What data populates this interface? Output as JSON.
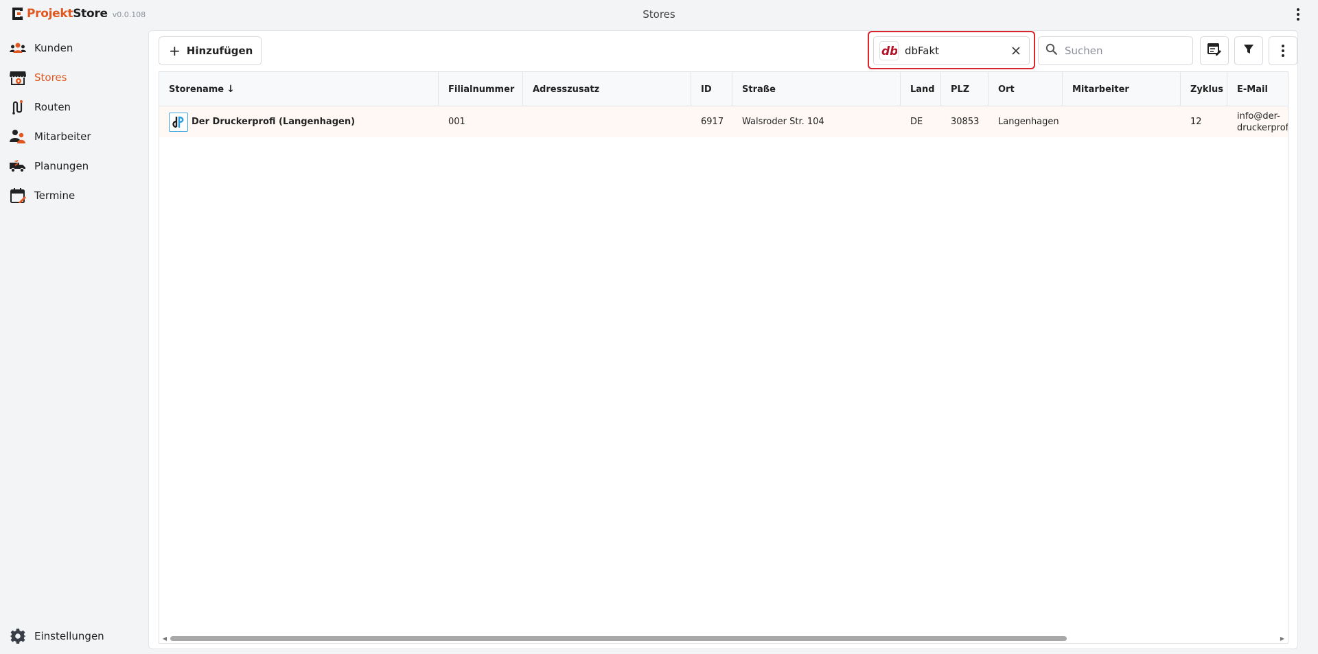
{
  "app": {
    "name_part1": "Projekt",
    "name_part2": "Store",
    "version": "v0.0.108",
    "page_title": "Stores"
  },
  "sidebar": {
    "items": [
      {
        "label": "Kunden",
        "icon": "people-icon"
      },
      {
        "label": "Stores",
        "icon": "store-icon",
        "active": true
      },
      {
        "label": "Routen",
        "icon": "route-icon"
      },
      {
        "label": "Mitarbeiter",
        "icon": "employees-icon"
      },
      {
        "label": "Planungen",
        "icon": "truck-icon"
      },
      {
        "label": "Termine",
        "icon": "calendar-icon"
      }
    ],
    "settings_label": "Einstellungen"
  },
  "toolbar": {
    "add_label": "Hinzufügen",
    "filter_chip_label": "dbFakt",
    "filter_chip_logo_text": "db",
    "search_placeholder": "Suchen"
  },
  "table": {
    "columns": [
      "Storename",
      "Filialnummer",
      "Adresszusatz",
      "ID",
      "Straße",
      "Land",
      "PLZ",
      "Ort",
      "Mitarbeiter",
      "Zyklus",
      "E-Mail"
    ],
    "sorted_column": "Storename",
    "sort_arrow": "↓",
    "rows": [
      {
        "storename": "Der Druckerprofi (Langenhagen)",
        "filialnummer": "001",
        "adresszusatz": "",
        "id": "6917",
        "strasse": "Walsroder Str. 104",
        "land": "DE",
        "plz": "30853",
        "ort": "Langenhagen",
        "mitarbeiter": "",
        "zyklus": "12",
        "email": "info@der-druckerprofi.de"
      }
    ]
  },
  "colors": {
    "accent": "#e1571f",
    "highlight_border": "#d8242a",
    "brand_db": "#b5122a"
  }
}
